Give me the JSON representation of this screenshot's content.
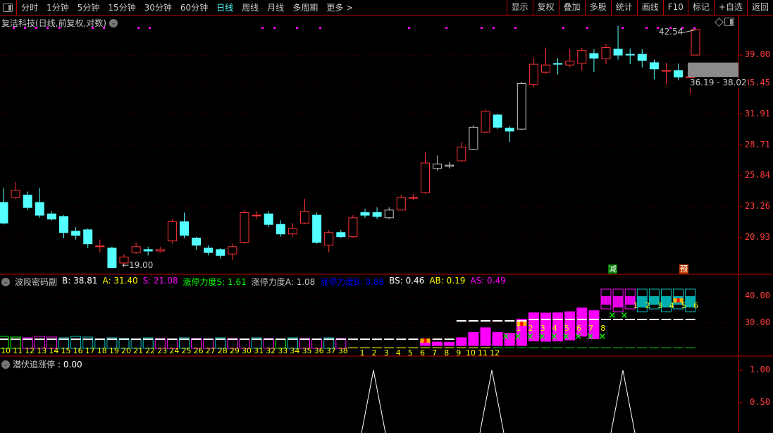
{
  "toolbar": {
    "periods": [
      "分时",
      "1分钟",
      "5分钟",
      "15分钟",
      "30分钟",
      "60分钟",
      "日线",
      "周线",
      "月线",
      "多周期",
      "更多 >"
    ],
    "active_period": "日线",
    "right_buttons": [
      "显示",
      "复权",
      "叠加",
      "多股",
      "统计",
      "画线",
      "F10",
      "标记",
      "+自选",
      "返回"
    ]
  },
  "chart_title": "复洁科技(日线,前复权,对数)",
  "price_axis": [
    "39.00",
    "35.45",
    "31.91",
    "28.71",
    "25.84",
    "23.26",
    "20.93"
  ],
  "annotations": {
    "high_label": "42.54",
    "low_label": "19.00",
    "range_label": "36.19 - 38.02",
    "tag_reduce": "减",
    "tag_predict": "预"
  },
  "colors": {
    "up": "#ff3232",
    "down": "#54ffff",
    "flat": "#c8c8c8",
    "axis": "#ff3c3c",
    "grid": "#c00000",
    "signal": "#ff00ff"
  },
  "candles": [
    [
      23.6,
      24.8,
      21.9,
      22.0
    ],
    [
      24.0,
      25.3,
      23.9,
      24.6
    ],
    [
      24.2,
      24.5,
      23.0,
      23.2
    ],
    [
      23.6,
      24.8,
      22.4,
      22.6
    ],
    [
      22.7,
      22.9,
      22.2,
      22.3
    ],
    [
      22.5,
      22.6,
      20.9,
      21.3
    ],
    [
      21.4,
      21.7,
      20.8,
      21.1
    ],
    [
      21.5,
      21.6,
      20.2,
      20.5
    ],
    [
      20.3,
      20.8,
      19.9,
      20.35
    ],
    [
      20.2,
      20.3,
      18.9,
      18.9
    ],
    [
      19.2,
      19.8,
      19.0,
      19.6
    ],
    [
      19.9,
      20.6,
      19.8,
      20.3
    ],
    [
      20.1,
      20.3,
      19.7,
      20.0
    ],
    [
      20.0,
      20.3,
      19.9,
      20.1
    ],
    [
      20.7,
      22.3,
      20.5,
      22.1
    ],
    [
      22.1,
      22.8,
      20.9,
      21.1
    ],
    [
      20.9,
      21.0,
      20.1,
      20.4
    ],
    [
      20.2,
      20.4,
      19.7,
      19.9
    ],
    [
      20.1,
      20.2,
      19.5,
      19.7
    ],
    [
      19.8,
      20.5,
      19.4,
      20.3
    ],
    [
      20.6,
      23.0,
      20.5,
      22.8
    ],
    [
      22.6,
      22.9,
      22.3,
      22.6
    ],
    [
      22.7,
      22.9,
      21.7,
      21.9
    ],
    [
      21.9,
      22.2,
      21.0,
      21.2
    ],
    [
      21.2,
      22.0,
      21.0,
      21.6
    ],
    [
      22.0,
      23.9,
      21.9,
      22.9
    ],
    [
      22.6,
      22.8,
      20.5,
      20.6
    ],
    [
      20.4,
      21.5,
      19.9,
      21.3
    ],
    [
      21.3,
      21.5,
      20.9,
      21.0
    ],
    [
      21.0,
      22.6,
      20.9,
      22.4
    ],
    [
      22.8,
      23.1,
      22.4,
      22.6
    ],
    [
      22.8,
      23.2,
      22.3,
      22.5
    ],
    [
      22.4,
      23.2,
      22.3,
      23.0
    ],
    [
      23.0,
      24.2,
      23.0,
      24.0
    ],
    [
      24.0,
      24.3,
      23.8,
      24.0
    ],
    [
      24.4,
      28.0,
      24.3,
      27.0
    ],
    [
      26.5,
      27.7,
      26.3,
      26.9
    ],
    [
      26.7,
      27.1,
      26.5,
      26.8
    ],
    [
      27.2,
      29.0,
      27.1,
      28.5
    ],
    [
      28.3,
      30.7,
      28.2,
      30.5
    ],
    [
      30.0,
      32.4,
      29.9,
      32.2
    ],
    [
      31.8,
      31.9,
      30.3,
      30.5
    ],
    [
      30.4,
      30.6,
      29.0,
      30.1
    ],
    [
      30.3,
      35.6,
      30.2,
      35.4
    ],
    [
      35.3,
      38.6,
      35.0,
      37.8
    ],
    [
      36.8,
      40.0,
      36.6,
      37.7
    ],
    [
      37.9,
      38.6,
      36.5,
      37.8
    ],
    [
      37.7,
      39.8,
      37.4,
      38.2
    ],
    [
      37.9,
      40.0,
      37.0,
      39.6
    ],
    [
      39.2,
      39.8,
      36.8,
      38.6
    ],
    [
      38.5,
      40.5,
      37.8,
      40.0
    ],
    [
      39.8,
      43.1,
      38.4,
      39.0
    ],
    [
      39.1,
      39.9,
      37.8,
      39.0
    ],
    [
      39.1,
      39.8,
      37.4,
      38.3
    ],
    [
      38.0,
      38.4,
      35.9,
      37.2
    ],
    [
      37.0,
      38.0,
      35.3,
      37.0
    ],
    [
      37.0,
      37.9,
      35.8,
      36.2
    ],
    [
      36.2,
      36.8,
      34.2,
      36.2
    ]
  ],
  "indicator": {
    "name": "波段密码副",
    "values": [
      {
        "label": "B: 38.81",
        "color": "#ffffff"
      },
      {
        "label": "A: 31.40",
        "color": "#ffff00"
      },
      {
        "label": "S: 21.08",
        "color": "#ff00ff"
      },
      {
        "label": "涨停力度S: 1.61",
        "color": "#00ff00"
      },
      {
        "label": "涨停力度A: 1.08",
        "color": "#c8c8c8"
      },
      {
        "label": "涨停力度B: 0.88",
        "color": "#0000ff"
      },
      {
        "label": "BS: 0.46",
        "color": "#ffffff"
      },
      {
        "label": "AB: 0.19",
        "color": "#ffff00"
      },
      {
        "label": "AS: 0.49",
        "color": "#ff00ff"
      }
    ],
    "axis": [
      "40.00",
      "30.00"
    ],
    "count_row_1": [
      "10",
      "11",
      "12",
      "13",
      "14",
      "15",
      "16",
      "17",
      "18",
      "19",
      "20",
      "21",
      "22",
      "23",
      "24",
      "25",
      "26",
      "27",
      "28",
      "29",
      "30",
      "31",
      "32",
      "33",
      "34",
      "35",
      "36",
      "37",
      "38"
    ],
    "count_row_2": [
      "1",
      "2",
      "3",
      "4",
      "5",
      "6",
      "7",
      "8",
      "9",
      "10",
      "11",
      "12"
    ],
    "count_row_3": [
      "1",
      "2",
      "3",
      "4",
      "5",
      "6",
      "7",
      "8"
    ],
    "count_row_4": [
      "1",
      "2",
      "3",
      "4",
      "5",
      "6"
    ]
  },
  "lower": {
    "name": "潜伏追涨停",
    "value": ": 0.00",
    "axis": [
      "1.00",
      "0.50"
    ]
  }
}
